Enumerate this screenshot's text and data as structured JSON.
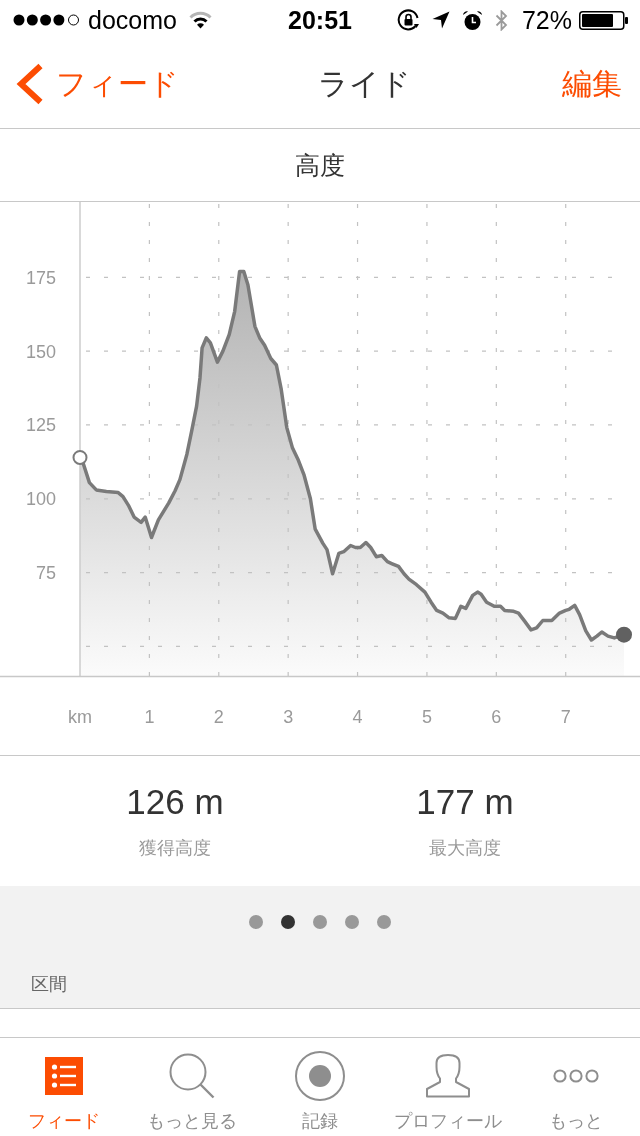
{
  "status_bar": {
    "carrier": "docomo",
    "time": "20:51",
    "battery": "72%"
  },
  "nav_bar": {
    "back": "フィード",
    "title": "ライド",
    "action": "編集"
  },
  "section_title": "高度",
  "elevation_chart": {
    "chart_data": {
      "type": "area",
      "grid": true,
      "x": [
        0,
        0.05,
        0.135,
        0.235,
        0.38,
        0.55,
        0.62,
        0.705,
        0.78,
        0.88,
        0.94,
        1.03,
        1.13,
        1.28,
        1.37,
        1.44,
        1.54,
        1.61,
        1.68,
        1.73,
        1.76,
        1.82,
        1.88,
        1.98,
        2.06,
        2.15,
        2.23,
        2.3,
        2.36,
        2.42,
        2.52,
        2.59,
        2.66,
        2.75,
        2.83,
        2.9,
        2.98,
        3.06,
        3.14,
        3.23,
        3.32,
        3.39,
        3.5,
        3.56,
        3.64,
        3.73,
        3.8,
        3.9,
        3.97,
        4.04,
        4.12,
        4.19,
        4.27,
        4.35,
        4.43,
        4.5,
        4.59,
        4.67,
        4.74,
        4.85,
        4.97,
        5.06,
        5.14,
        5.23,
        5.32,
        5.41,
        5.49,
        5.56,
        5.66,
        5.73,
        5.78,
        5.86,
        5.97,
        6.06,
        6.12,
        6.25,
        6.32,
        6.41,
        6.5,
        6.58,
        6.67,
        6.8,
        6.91,
        7,
        7.05,
        7.13,
        7.2,
        7.29,
        7.37,
        7.45,
        7.52,
        7.61,
        7.7,
        7.84
      ],
      "series": [
        {
          "color": "#7a7a7a",
          "values": [
            114,
            111.7,
            105.5,
            103,
            102.5,
            102.1,
            100.7,
            97.5,
            93.8,
            92,
            93.8,
            86.9,
            92.9,
            98.6,
            102.7,
            106.5,
            115.1,
            123,
            131.4,
            141,
            151.1,
            154.5,
            152.8,
            146.3,
            150,
            155.6,
            163.5,
            177,
            177,
            172.5,
            158.4,
            154.5,
            152,
            147.5,
            145.3,
            137.1,
            124.1,
            117.4,
            113.4,
            108,
            100,
            89.7,
            84.9,
            82.8,
            74.6,
            81.5,
            82.1,
            84.2,
            83.5,
            83.5,
            85.2,
            83.5,
            80.4,
            80.8,
            78.7,
            78,
            77.1,
            74.6,
            72.8,
            70.9,
            68.4,
            65,
            62.2,
            61.3,
            59.7,
            59.5,
            63.6,
            62.9,
            67.3,
            68.4,
            67.7,
            65,
            63.6,
            63.6,
            62.2,
            61.9,
            61.3,
            58.5,
            55.6,
            56.3,
            58.8,
            58.8,
            61.3,
            62.2,
            62.6,
            63.9,
            60.8,
            55.3,
            52.2,
            53.5,
            54.9,
            53.5,
            52.9,
            54
          ]
        }
      ],
      "xlim": [
        0,
        7.84
      ],
      "ylim": [
        40,
        200.5
      ],
      "xticks": [
        {
          "value": 0,
          "label": "km"
        },
        1,
        2,
        3,
        4,
        5,
        6,
        7
      ],
      "yticks": [
        75,
        100,
        125,
        150,
        175
      ]
    }
  },
  "stats": [
    {
      "value": "126 m",
      "label": "獲得高度"
    },
    {
      "value": "177 m",
      "label": "最大高度"
    }
  ],
  "pager": [
    {
      "selected": false
    },
    {
      "selected": true
    },
    {
      "selected": false
    },
    {
      "selected": false
    },
    {
      "selected": false
    }
  ],
  "segments": {
    "header": "区間"
  },
  "tab_bar": [
    {
      "label": "フィード",
      "selected": true
    },
    {
      "label": "もっと見る",
      "selected": false
    },
    {
      "label": "記録",
      "selected": false
    },
    {
      "label": "プロフィール",
      "selected": false
    },
    {
      "label": "もっと",
      "selected": false
    }
  ]
}
